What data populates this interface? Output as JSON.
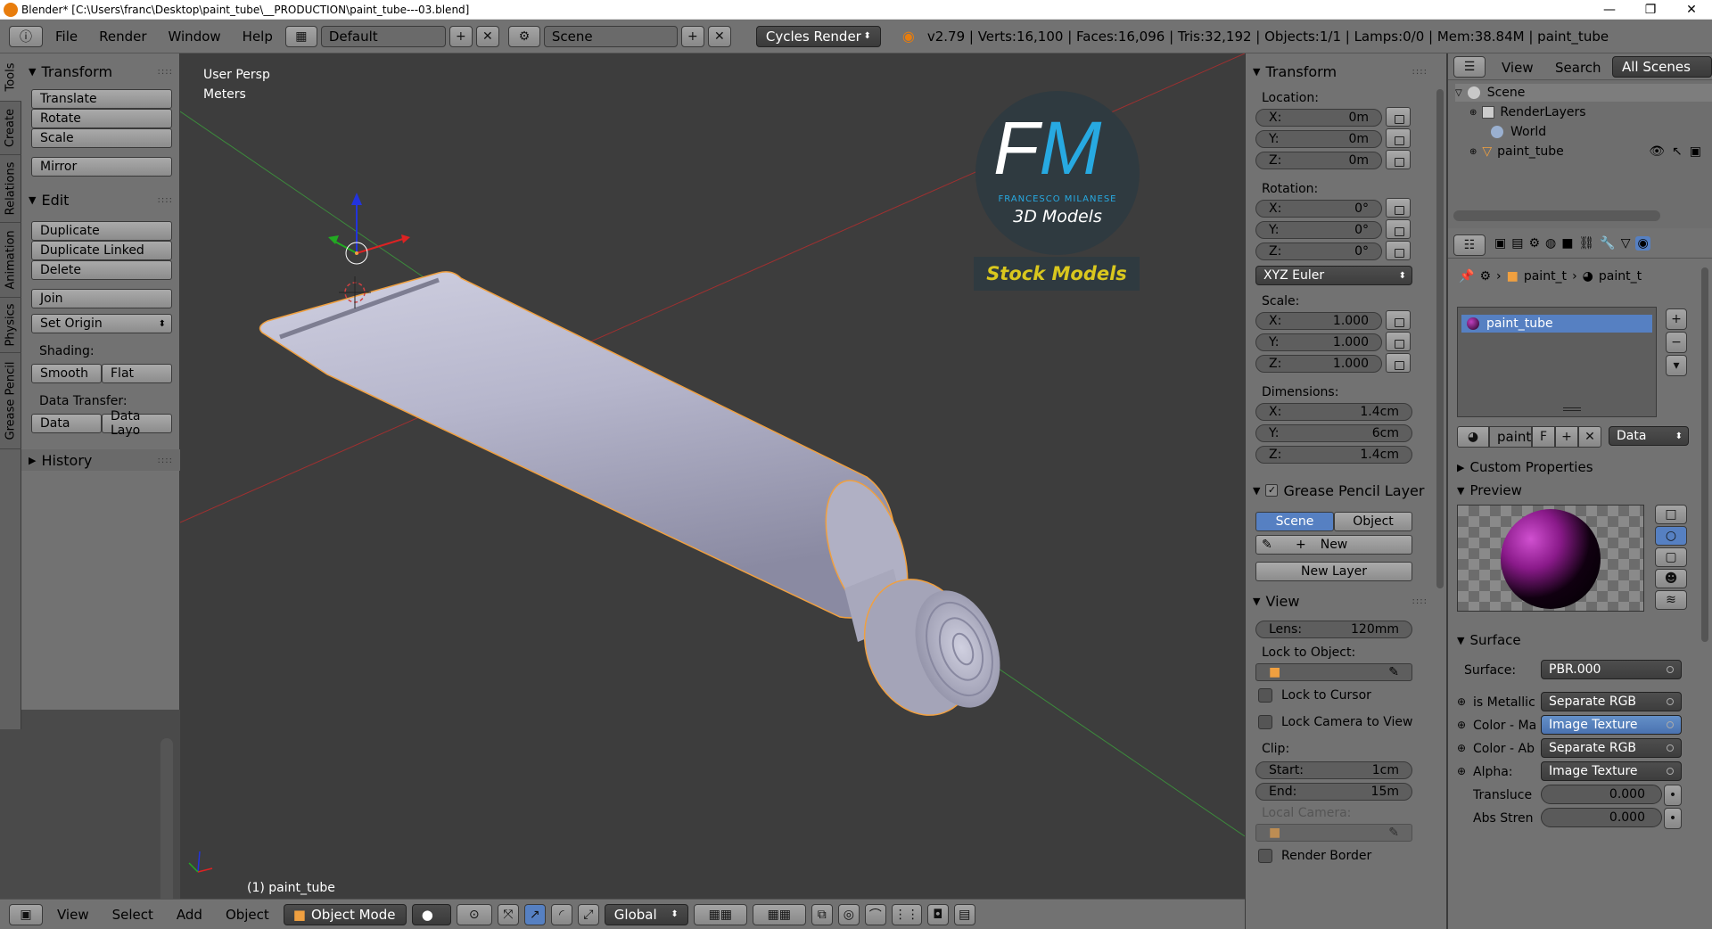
{
  "window": {
    "title": "Blender* [C:\\Users\\franc\\Desktop\\paint_tube\\__PRODUCTION\\paint_tube---03.blend]",
    "minimize": "—",
    "maximize": "❐",
    "close": "✕"
  },
  "topbar": {
    "menus": [
      "File",
      "Render",
      "Window",
      "Help"
    ],
    "layout": "Default",
    "scene": "Scene",
    "engine": "Cycles Render",
    "stats": "v2.79 | Verts:16,100 | Faces:16,096 | Tris:32,192 | Objects:1/1 | Lamps:0/0 | Mem:38.84M | paint_tube"
  },
  "left_tabs": [
    "Tools",
    "Create",
    "Relations",
    "Animation",
    "Physics",
    "Grease Pencil"
  ],
  "tool_shelf": {
    "transform_title": "Transform",
    "translate": "Translate",
    "rotate": "Rotate",
    "scale": "Scale",
    "mirror": "Mirror",
    "edit_title": "Edit",
    "duplicate": "Duplicate",
    "duplicate_linked": "Duplicate Linked",
    "delete": "Delete",
    "join": "Join",
    "set_origin": "Set Origin",
    "shading_label": "Shading:",
    "smooth": "Smooth",
    "flat": "Flat",
    "data_transfer_label": "Data Transfer:",
    "data": "Data",
    "data_layo": "Data Layo",
    "history_title": "History"
  },
  "viewport": {
    "view_name": "User Persp",
    "units": "Meters",
    "object_label": "(1) paint_tube",
    "logo_letters": "FM",
    "logo_name": "FRANCESCO MILANESE",
    "logo_sub": "3D Models",
    "logo_banner": "Stock Models"
  },
  "viewport_header": {
    "menus": [
      "View",
      "Select",
      "Add",
      "Object"
    ],
    "mode": "Object Mode",
    "orientation": "Global"
  },
  "npanel": {
    "transform_title": "Transform",
    "location_label": "Location:",
    "loc": [
      [
        "X:",
        "0m"
      ],
      [
        "Y:",
        "0m"
      ],
      [
        "Z:",
        "0m"
      ]
    ],
    "rotation_label": "Rotation:",
    "rot": [
      [
        "X:",
        "0°"
      ],
      [
        "Y:",
        "0°"
      ],
      [
        "Z:",
        "0°"
      ]
    ],
    "rotation_mode": "XYZ Euler",
    "scale_label": "Scale:",
    "scl": [
      [
        "X:",
        "1.000"
      ],
      [
        "Y:",
        "1.000"
      ],
      [
        "Z:",
        "1.000"
      ]
    ],
    "dimensions_label": "Dimensions:",
    "dim": [
      [
        "X:",
        "1.4cm"
      ],
      [
        "Y:",
        "6cm"
      ],
      [
        "Z:",
        "1.4cm"
      ]
    ],
    "grease_title": "Grease Pencil Layer",
    "scene_btn": "Scene",
    "object_btn": "Object",
    "new_btn": "New",
    "new_layer_btn": "New Layer",
    "view_title": "View",
    "lens_label": "Lens:",
    "lens_value": "120mm",
    "lock_object_label": "Lock to Object:",
    "lock_cursor": "Lock to Cursor",
    "lock_camera": "Lock Camera to View",
    "clip_label": "Clip:",
    "clip_start_label": "Start:",
    "clip_start": "1cm",
    "clip_end_label": "End:",
    "clip_end": "15m",
    "local_camera_label": "Local Camera:",
    "render_border": "Render Border"
  },
  "outliner": {
    "view": "View",
    "search": "Search",
    "filter": "All Scenes",
    "scene": "Scene",
    "render_layers": "RenderLayers",
    "world": "World",
    "object": "paint_tube"
  },
  "properties": {
    "breadcrumb_1": "paint_t",
    "breadcrumb_2": "paint_t",
    "material_slot": "paint_tube",
    "mat_name": "paint",
    "fake_user": "F",
    "link": "Data",
    "custom_props": "Custom Properties",
    "preview": "Preview",
    "surface_title": "Surface",
    "surface_label": "Surface:",
    "surface_value": "PBR.000",
    "rows": [
      {
        "label": "is Metallic",
        "value": "Separate RGB"
      },
      {
        "label": "Color - Ma",
        "value": "Image Texture"
      },
      {
        "label": "Color - Ab",
        "value": "Separate RGB"
      },
      {
        "label": "Alpha:",
        "value": "Image Texture"
      }
    ],
    "transluce_label": "Transluce",
    "transluce_value": "0.000",
    "abs_label": "Abs Stren",
    "abs_value": "0.000"
  },
  "colors": {
    "accent_blue": "#5680c2",
    "object_orange": "#f0a040",
    "logo_blue": "#27a9e1",
    "banner_yellow": "#d9c71e"
  }
}
